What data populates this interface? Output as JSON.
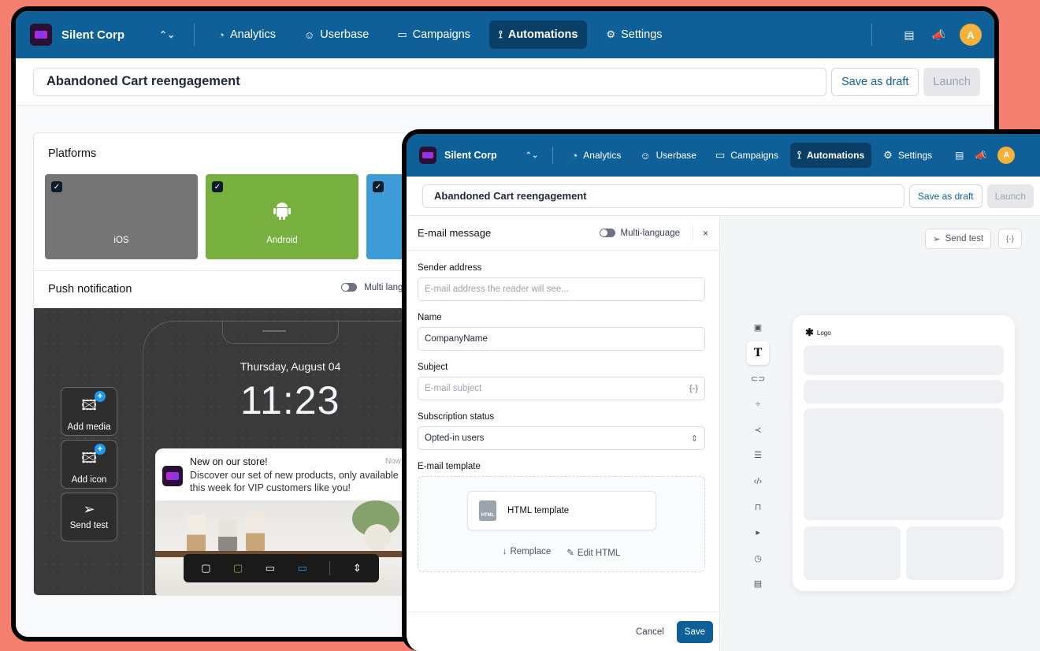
{
  "brand": {
    "name": "Silent Corp"
  },
  "nav": {
    "items": [
      {
        "label": "Analytics",
        "icon": "analytics-icon"
      },
      {
        "label": "Userbase",
        "icon": "users-icon"
      },
      {
        "label": "Campaigns",
        "icon": "campaigns-icon"
      },
      {
        "label": "Automations",
        "icon": "automations-icon",
        "active": true
      },
      {
        "label": "Settings",
        "icon": "gear-icon"
      }
    ],
    "avatar_initial": "A"
  },
  "campaign": {
    "title": "Abandoned Cart reengagement",
    "save_draft_label": "Save as draft",
    "launch_label": "Launch"
  },
  "platforms": {
    "heading": "Platforms",
    "items": [
      {
        "label": "iOS",
        "checked": true,
        "color": "#757575"
      },
      {
        "label": "Android",
        "checked": true,
        "color": "#78b040"
      },
      {
        "label": "",
        "checked": true,
        "color": "#3d9bd8"
      }
    ]
  },
  "push": {
    "heading": "Push notification",
    "multilang_label": "Multi lang",
    "date": "Thursday, August 04",
    "time": "11:23",
    "side_buttons": {
      "add_media": "Add media",
      "add_icon": "Add icon",
      "send_test": "Send test"
    },
    "notification": {
      "title": "New on our store!",
      "time": "Now",
      "body": "Discover our set of new products, only available this week for VIP customers like you!"
    }
  },
  "email": {
    "panel_title": "E-mail message",
    "multilang_label": "Multi-language",
    "close_label": "×",
    "sender": {
      "label": "Sender address",
      "placeholder": "E-mail address the reader will see..."
    },
    "name": {
      "label": "Name",
      "value": "CompanyName"
    },
    "subject": {
      "label": "Subject",
      "placeholder": "E-mail subject",
      "suffix": "{-}"
    },
    "subscription": {
      "label": "Subscription status",
      "value": "Opted-in users"
    },
    "template": {
      "label": "E-mail template",
      "card_label": "HTML template",
      "icon_text": "HTML",
      "replace_label": "Remplace",
      "edit_label": "Edit HTML"
    },
    "cancel_label": "Cancel",
    "save_label": "Save"
  },
  "canvas": {
    "send_test_label": "Send test",
    "var_label": "{-}",
    "logo_label": "Logo",
    "tools": [
      "image-block-icon",
      "text-block-icon",
      "button-block-icon",
      "divider-block-icon",
      "social-block-icon",
      "spacer-block-icon",
      "code-block-icon",
      "product-block-icon",
      "video-block-icon",
      "timer-block-icon",
      "footer-block-icon"
    ]
  }
}
